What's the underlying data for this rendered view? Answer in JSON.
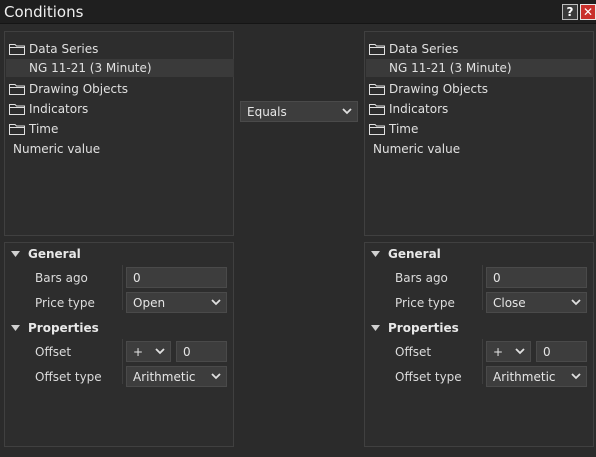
{
  "window": {
    "title": "Conditions",
    "help_label": "?",
    "close_label": "✕"
  },
  "operator": {
    "selected": "Equals"
  },
  "left": {
    "tree": {
      "data_series": "Data Series",
      "series_item": "NG 11-21 (3 Minute)",
      "drawing_objects": "Drawing Objects",
      "indicators": "Indicators",
      "time": "Time",
      "numeric_value": "Numeric value"
    },
    "props": {
      "general": "General",
      "bars_ago_label": "Bars ago",
      "bars_ago_value": "0",
      "price_type_label": "Price type",
      "price_type_value": "Open",
      "properties": "Properties",
      "offset_label": "Offset",
      "offset_sign": "+",
      "offset_value": "0",
      "offset_type_label": "Offset type",
      "offset_type_value": "Arithmetic"
    }
  },
  "right": {
    "tree": {
      "data_series": "Data Series",
      "series_item": "NG 11-21 (3 Minute)",
      "drawing_objects": "Drawing Objects",
      "indicators": "Indicators",
      "time": "Time",
      "numeric_value": "Numeric value"
    },
    "props": {
      "general": "General",
      "bars_ago_label": "Bars ago",
      "bars_ago_value": "0",
      "price_type_label": "Price type",
      "price_type_value": "Close",
      "properties": "Properties",
      "offset_label": "Offset",
      "offset_sign": "+",
      "offset_value": "0",
      "offset_type_label": "Offset type",
      "offset_type_value": "Arithmetic"
    }
  },
  "icons": {
    "folder": "folder-icon",
    "chevron": "chevron-down-icon",
    "collapse": "triangle-down-icon"
  },
  "colors": {
    "background": "#2b2b2b",
    "close_red": "#c9302c",
    "field_bg": "#3d3d3d"
  }
}
